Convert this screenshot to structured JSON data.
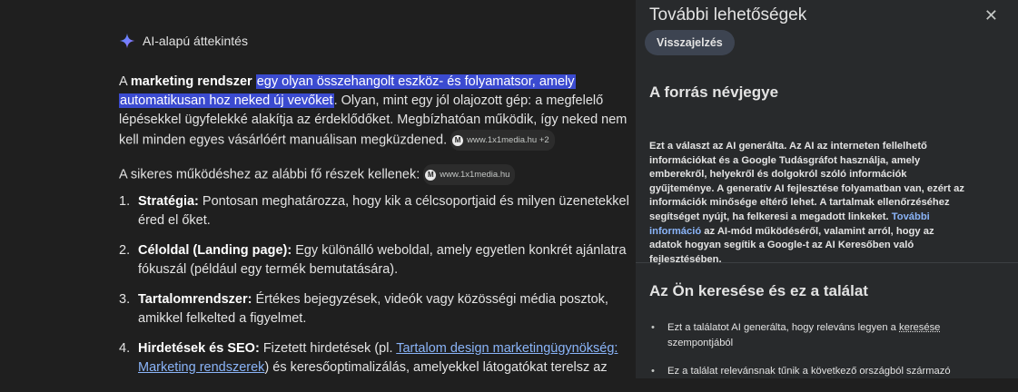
{
  "overview": {
    "heading": "AI-alapú áttekintés",
    "p1": {
      "a": "A ",
      "b": "marketing rendszer",
      "c": " ",
      "hl1": "egy olyan összehangolt eszköz- és folyamatsor, amely",
      "hl2": "automatikusan hoz neked új vevőket",
      "d": ". Olyan, mint egy jól olajozott gép: a megfelelő lépésekkel ügyfelekké alakítja az érdeklődőket. Megbízhatóan működik, így neked nem kell minden egyes vásárlóért manuálisan megküzdened.",
      "source": "www.1x1media.hu +2"
    },
    "p2": {
      "text": "A sikeres működéshez az alábbi fő részek kellenek:",
      "source": "www.1x1media.hu"
    },
    "items": [
      {
        "num": "1.",
        "title": "Stratégia:",
        "text": " Pontosan meghatározza, hogy kik a célcsoportjaid és milyen üzenetekkel éred el őket."
      },
      {
        "num": "2.",
        "title": "Céloldal (Landing page):",
        "text": " Egy különálló weboldal, amely egyetlen konkrét ajánlatra fókuszál (például egy termék bemutatására)."
      },
      {
        "num": "3.",
        "title": "Tartalomrendszer:",
        "text": " Értékes bejegyzések, videók vagy közösségi média posztok, amikkel felkelted a figyelmet."
      },
      {
        "num": "4.",
        "title": "Hirdetések és SEO:",
        "text_a": " Fizetett hirdetések (pl. ",
        "link": "Tartalom design marketingügynökség: Marketing rendszerek",
        "text_b": ") és keresőoptimalizálás, amelyekkel látogatókat terelsz az"
      }
    ]
  },
  "panel": {
    "title": "További lehetőségek",
    "close": "✕",
    "feedback_button": "Visszajelzés",
    "about_heading": "A forrás névjegye",
    "about_text_a": "Ezt a választ az AI generálta. Az AI az interneten fellelhető információkat és a Google Tudásgráfot használja, amely emberekről, helyekről és dolgokról szóló információk gyűjteménye. A generatív AI fejlesztése folyamatban van, ezért az információk minősége eltérő lehet. A tartalmak ellenőrzéséhez segítséget nyújt, ha felkeresi a megadott linkeket. ",
    "about_link": "További információ",
    "about_text_b": " az AI-mód működéséről, valamint arról, hogy az adatok hogyan segítik a Google-t az AI Keresőben való fejlesztésében.",
    "search_heading": "Az Ön keresése és ez a találat",
    "bullet1_a": "Ezt a találatot AI generálta, hogy releváns legyen a ",
    "bullet1_u": "keresése",
    "bullet1_b": " szempontjából",
    "bullet2": "Ez a találat relevánsnak tűnik a következő országból származó"
  }
}
